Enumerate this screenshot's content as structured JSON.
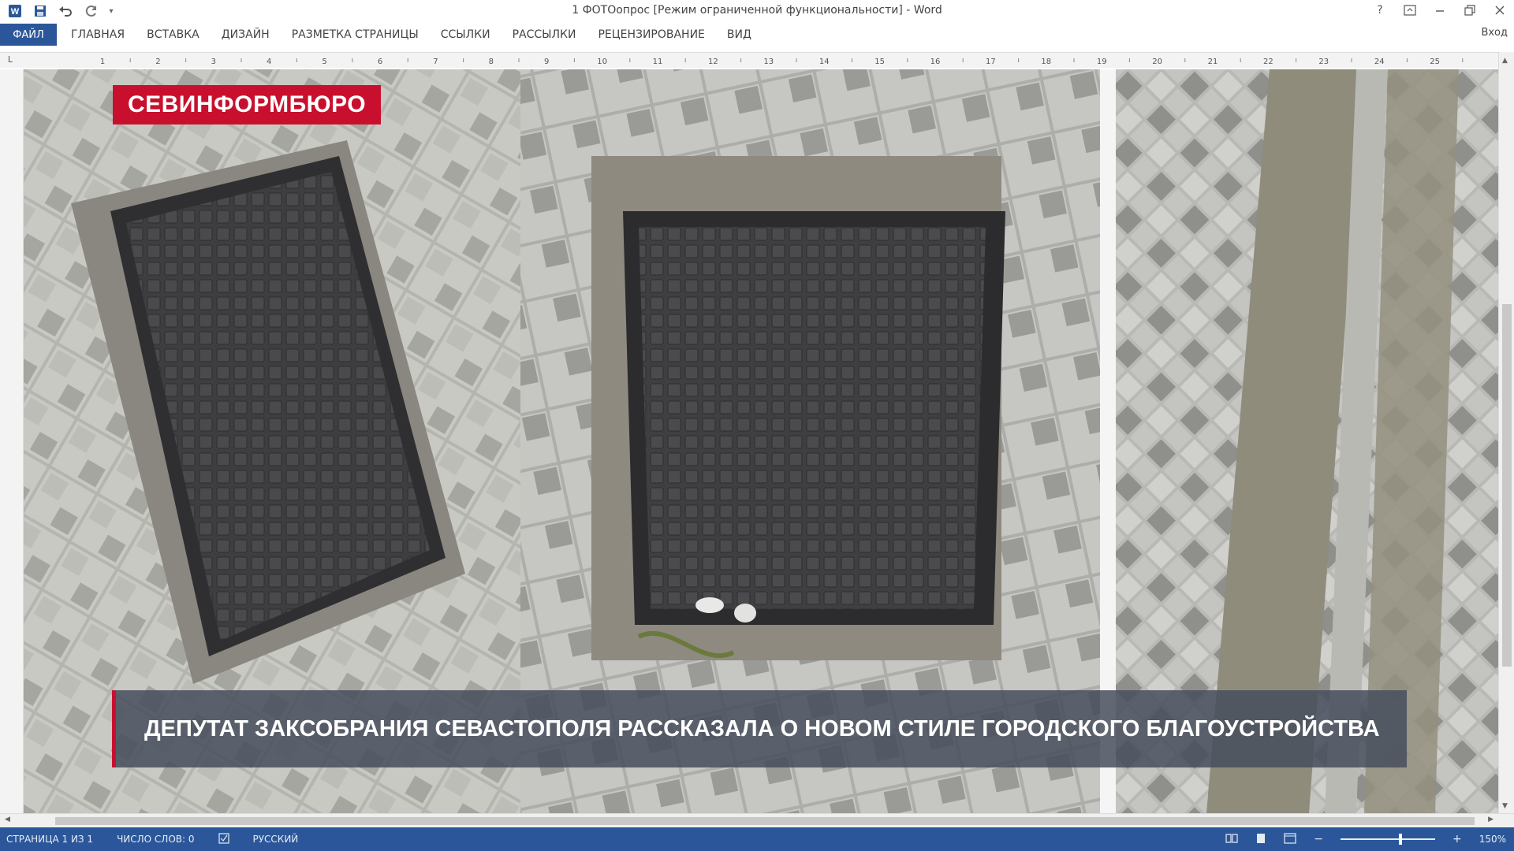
{
  "titlebar": {
    "title": "1 ФОТОопрос [Режим ограниченной функциональности] - Word",
    "icons": [
      "word-app-icon",
      "save-icon",
      "undo-icon",
      "redo-icon",
      "customize-qat-icon"
    ],
    "window_icons": [
      "help-icon",
      "ribbon-display-icon",
      "minimize-icon",
      "restore-icon",
      "close-icon"
    ]
  },
  "ribbon": {
    "file_tab": "ФАЙЛ",
    "tabs": [
      "ГЛАВНАЯ",
      "ВСТАВКА",
      "ДИЗАЙН",
      "РАЗМЕТКА СТРАНИЦЫ",
      "ССЫЛКИ",
      "РАССЫЛКИ",
      "РЕЦЕНЗИРОВАНИЕ",
      "ВИД"
    ],
    "signin": "Вход",
    "accent": "#2b579a"
  },
  "ruler": {
    "corner": "L",
    "ticks": [
      "1",
      "2",
      "3",
      "4",
      "5",
      "6",
      "7",
      "8",
      "9",
      "10",
      "11",
      "12",
      "13",
      "14",
      "15",
      "16",
      "17",
      "18",
      "19",
      "20",
      "21",
      "22",
      "23",
      "24",
      "25"
    ]
  },
  "document": {
    "brand_label": "СЕВИНФОРМБЮРО",
    "headline": "ДЕПУТАТ ЗАКСОБРАНИЯ СЕВАСТОПОЛЯ РАССКАЗАЛА О НОВОМ СТИЛЕ ГОРОДСКОГО БЛАГОУСТРОЙСТВА",
    "brand_color": "#c8102e"
  },
  "statusbar": {
    "page": "СТРАНИЦА 1 ИЗ 1",
    "words": "ЧИСЛО СЛОВ: 0",
    "language": "РУССКИЙ",
    "zoom": "150%"
  }
}
